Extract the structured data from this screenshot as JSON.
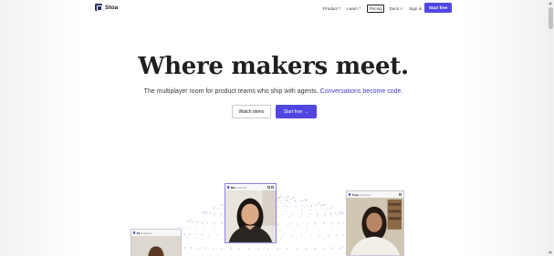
{
  "brand": {
    "name": "Stoa",
    "logo_icon": "stoa-logo-icon",
    "accent": "#5146e0"
  },
  "nav": {
    "product": "Product",
    "learn": "Learn",
    "pricing": "Pricing",
    "docs": "Docs",
    "sign_in": "Sign in",
    "start_free": "Start free"
  },
  "hero": {
    "title": "Where makers meet.",
    "subtitle": "The multiplayer room for product teams who ship with agents.",
    "subtitle_highlight": "Conversations become code.",
    "watch_demo": "Watch demo",
    "start_free": "Start free",
    "arrow": "→"
  },
  "tiles": [
    {
      "name": "Eli",
      "role": "Engineer"
    },
    {
      "name": "Mia",
      "role": "Founder"
    },
    {
      "name": "Priya",
      "role": "Designer"
    }
  ]
}
